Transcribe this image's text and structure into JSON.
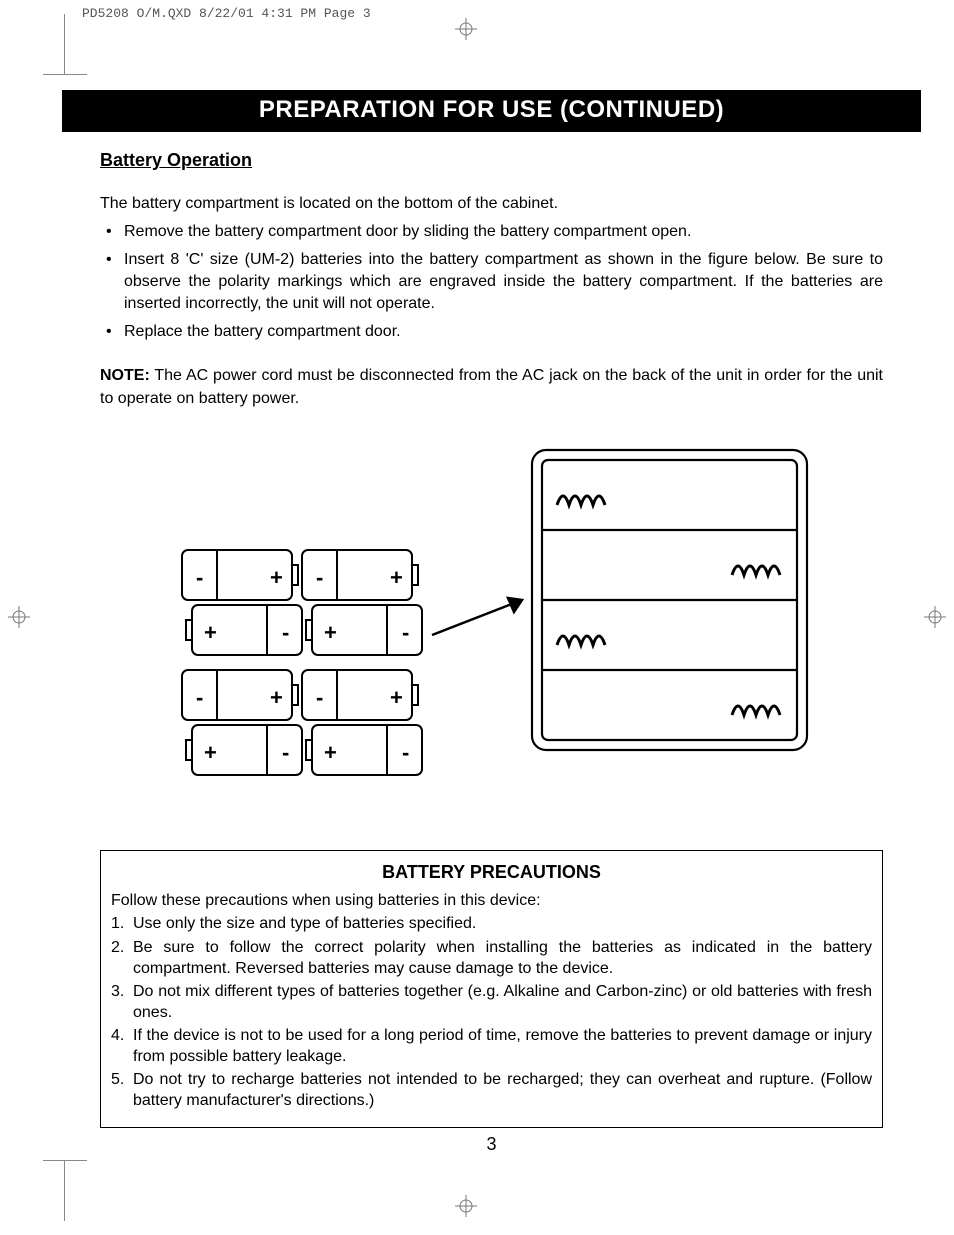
{
  "print_header": "PD5208 O/M.QXD  8/22/01  4:31 PM  Page 3",
  "title": "PREPARATION FOR USE (CONTINUED)",
  "section_heading": "Battery Operation",
  "intro": "The battery compartment is located on the bottom of the cabinet.",
  "bullets": [
    "Remove the battery compartment door by sliding the battery compartment open.",
    "Insert 8 'C' size (UM-2) batteries into the battery compartment as shown in the figure below. Be sure to observe the polarity markings which are engraved inside the battery compartment. If the batteries are inserted incorrectly, the unit will not operate.",
    "Replace the battery compartment door."
  ],
  "note_label": "NOTE:",
  "note_text": " The AC power cord must be disconnected from the AC jack on the back of the unit in order for the unit to operate on battery power.",
  "precautions": {
    "title": "BATTERY PRECAUTIONS",
    "intro": "Follow these precautions when using batteries in this device:",
    "items": [
      "Use only the size and type of batteries specified.",
      "Be sure to follow the correct polarity when installing the batteries as indicated in the battery compartment. Reversed batteries may cause damage to the device.",
      "Do not mix different types of batteries together (e.g. Alkaline and Carbon-zinc) or old batteries with fresh ones.",
      "If the device is not to be used for a long period of time, remove the batteries to prevent damage or injury from possible battery leakage.",
      "Do not try to recharge batteries not intended to be recharged; they can overheat and rupture. (Follow battery manufacturer's directions.)"
    ]
  },
  "page_number": "3"
}
